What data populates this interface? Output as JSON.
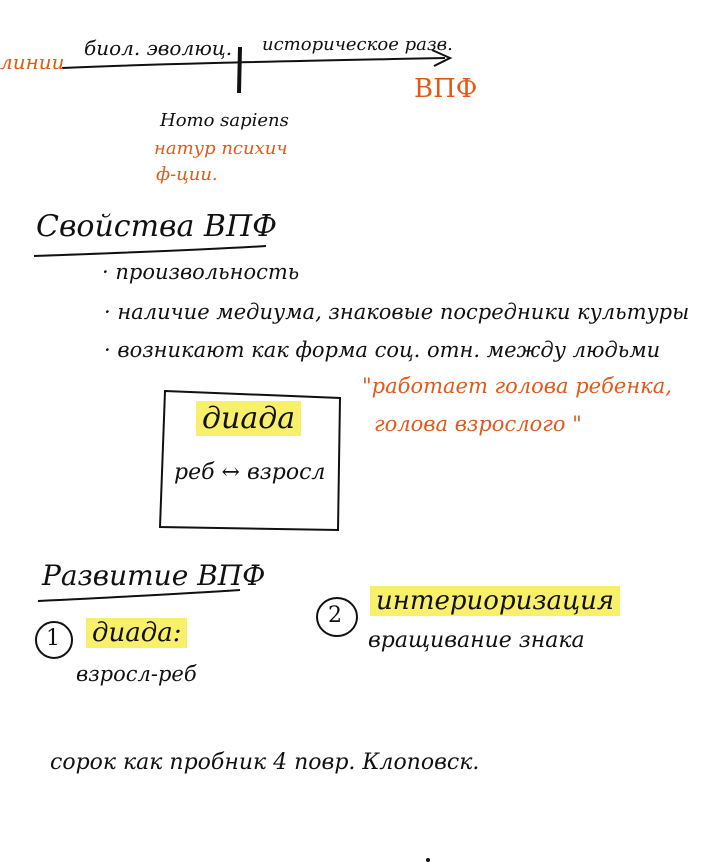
{
  "colors": {
    "ink": "#111111",
    "accent": "#e05a1a",
    "highlight": "#f8ef6a"
  },
  "timeline": {
    "left_label": "линии",
    "bio_label": "биол. эволюц.",
    "hist_label": "историческое разв.",
    "vpf_label": "ВПФ"
  },
  "homo": {
    "title": "Homo sapiens",
    "line1": "натур психич",
    "line2": "ф-ции."
  },
  "properties": {
    "heading": "Свойства ВПФ",
    "items": [
      "· произвольность",
      "· наличие медиума, знаковые посредники культуры",
      "· возникают как форма соц. отн. между людьми"
    ],
    "quote_line1": "\"работает голова ребенка,",
    "quote_line2": "голова взрослого \""
  },
  "diada_box": {
    "title": "диада",
    "relation": "реб ↔ взросл"
  },
  "development": {
    "heading": "Развитие ВПФ",
    "step1_number": "1",
    "step1_title": "диада:",
    "step1_sub": "взросл-реб",
    "step2_number": "2",
    "step2_title": "интериоризация",
    "step2_sub": "вращивание знака"
  },
  "footer_note": "сорок как пробник 4 повр. Клоповск."
}
